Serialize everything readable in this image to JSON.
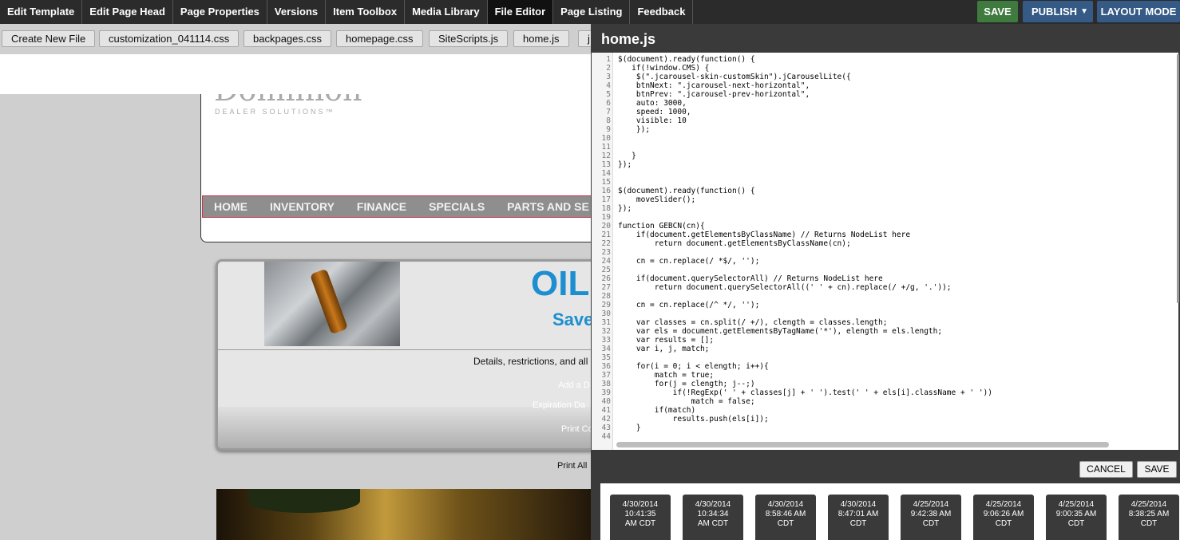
{
  "toolbar": {
    "tabs": [
      {
        "label": "Edit Template"
      },
      {
        "label": "Edit Page Head"
      },
      {
        "label": "Page Properties"
      },
      {
        "label": "Versions"
      },
      {
        "label": "Item Toolbox"
      },
      {
        "label": "Media Library"
      },
      {
        "label": "File Editor",
        "active": true
      },
      {
        "label": "Page Listing"
      },
      {
        "label": "Feedback"
      }
    ],
    "save_label": "SAVE",
    "publish_label": "PUBLISH",
    "publish_caret": "▼",
    "layout_label": "LAYOUT MODE",
    "colors": {
      "save": "#3f7a3f",
      "publish": "#355a86",
      "bar": "#2b2b2b"
    }
  },
  "files": {
    "create_label": "Create New File",
    "items": [
      "customization_041114.css",
      "backpages.css",
      "homepage.css",
      "SiteScripts.js",
      "home.js",
      "j"
    ]
  },
  "site": {
    "logo": "Dominion",
    "tagline": "DEALER SOLUTIONS™",
    "nav": [
      "HOME",
      "INVENTORY",
      "FINANCE",
      "SPECIALS",
      "PARTS AND SE"
    ],
    "coupon": {
      "title": "OIL",
      "subtitle": "Save",
      "details": "Details, restrictions, and all",
      "add": "Add a D",
      "expiration": "Expiration Da",
      "print": "Print Co"
    },
    "print_all": "Print All"
  },
  "editor": {
    "title": "home.js",
    "lines": [
      "$(document).ready(function() {",
      "   if(!window.CMS) {",
      "    $(\".jcarousel-skin-customSkin\").jCarouselLite({",
      "    btnNext: \".jcarousel-next-horizontal\",",
      "    btnPrev: \".jcarousel-prev-horizontal\",",
      "    auto: 3000,",
      "    speed: 1000,",
      "    visible: 10",
      "    });",
      "",
      "",
      "   }",
      "});",
      "",
      "",
      "$(document).ready(function() {",
      "    moveSlider();",
      "});",
      "",
      "function GEBCN(cn){",
      "    if(document.getElementsByClassName) // Returns NodeList here",
      "        return document.getElementsByClassName(cn);",
      "",
      "    cn = cn.replace(/ *$/, '');",
      "",
      "    if(document.querySelectorAll) // Returns NodeList here",
      "        return document.querySelectorAll((' ' + cn).replace(/ +/g, '.'));",
      "",
      "    cn = cn.replace(/^ */, '');",
      "",
      "    var classes = cn.split(/ +/), clength = classes.length;",
      "    var els = document.getElementsByTagName('*'), elength = els.length;",
      "    var results = [];",
      "    var i, j, match;",
      "",
      "    for(i = 0; i < elength; i++){",
      "        match = true;",
      "        for(j = clength; j--;)",
      "            if(!RegExp(' ' + classes[j] + ' ').test(' ' + els[i].className + ' '))",
      "                match = false;",
      "        if(match)",
      "            results.push(els[i]);",
      "    }",
      ""
    ],
    "cancel_label": "CANCEL",
    "save_label": "SAVE"
  },
  "versions": [
    {
      "date": "4/30/2014",
      "time": "10:41:35",
      "tz": "AM CDT"
    },
    {
      "date": "4/30/2014",
      "time": "10:34:34",
      "tz": "AM CDT"
    },
    {
      "date": "4/30/2014",
      "time": "8:58:46 AM",
      "tz": "CDT"
    },
    {
      "date": "4/30/2014",
      "time": "8:47:01 AM",
      "tz": "CDT"
    },
    {
      "date": "4/25/2014",
      "time": "9:42:38 AM",
      "tz": "CDT"
    },
    {
      "date": "4/25/2014",
      "time": "9:06:26 AM",
      "tz": "CDT"
    },
    {
      "date": "4/25/2014",
      "time": "9:00:35 AM",
      "tz": "CDT"
    },
    {
      "date": "4/25/2014",
      "time": "8:38:25 AM",
      "tz": "CDT"
    }
  ]
}
